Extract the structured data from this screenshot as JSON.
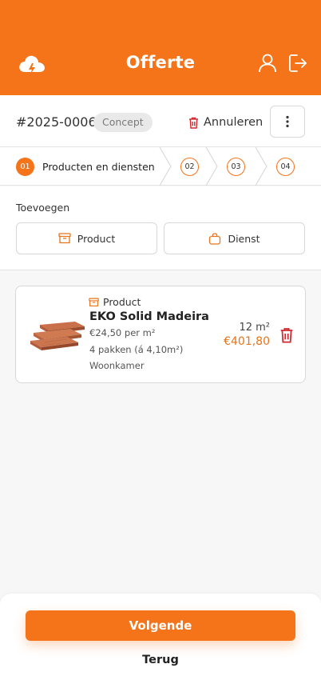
{
  "header": {
    "title": "Offerte",
    "logo_icon": "cloud-bolt-icon",
    "user_icon": "user-icon",
    "logout_icon": "logout-icon",
    "bg_color": "#f5741a"
  },
  "order": {
    "number": "#2025-0006",
    "status": "Concept",
    "cancel_label": "Annuleren",
    "cancel_icon": "trash-icon",
    "more_icon": "more-vertical-icon"
  },
  "stepper": {
    "steps": [
      {
        "number": "01",
        "label": "Producten en diensten",
        "active": true
      },
      {
        "number": "02",
        "label": "",
        "active": false
      },
      {
        "number": "03",
        "label": "",
        "active": false
      },
      {
        "number": "04",
        "label": "",
        "active": false
      }
    ]
  },
  "add": {
    "title": "Toevoegen",
    "product_label": "Product",
    "product_icon": "box-icon",
    "dienst_label": "Dienst",
    "dienst_icon": "bag-icon"
  },
  "items": [
    {
      "type_label": "Product",
      "type_icon": "box-icon",
      "name": "EKO Solid Madeira",
      "price_per_unit": "€24,50 per m²",
      "packs": "4 pakken (á 4,10m²)",
      "room": "Woonkamer",
      "quantity": "12 m²",
      "total": "€401,80",
      "image_icon": "wood-planks-icon",
      "delete_icon": "trash-icon"
    }
  ],
  "footer": {
    "next_label": "Volgende",
    "back_label": "Terug"
  },
  "colors": {
    "accent": "#f5741a",
    "price": "#e8741c",
    "delete": "#d0272e"
  }
}
